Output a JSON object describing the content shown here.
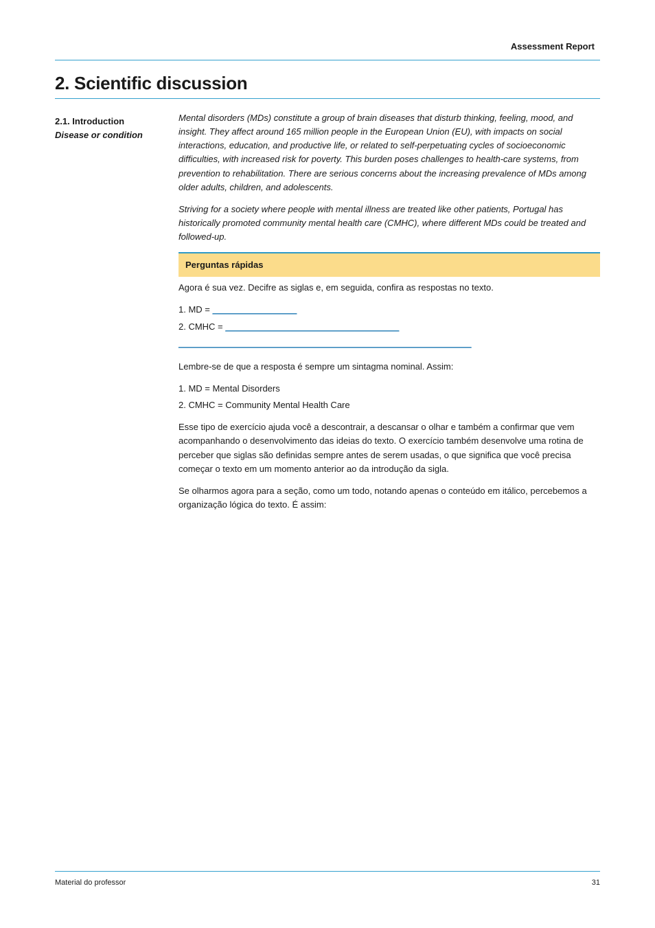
{
  "header": {
    "doc_title": "Assessment Report"
  },
  "section": {
    "number": "2.",
    "title": "Scientific discussion"
  },
  "left": {
    "heading": "2.1. Introduction",
    "sub": "Disease or condition"
  },
  "paragraphs": {
    "p1": "Mental disorders (MDs) constitute a group of brain diseases that disturb thinking, feeling, mood, and insight. They affect around 165 million people in the European Union (EU), with impacts on social interactions, education, and productive life, or related to self-perpetuating cycles of socioeconomic difficulties, with increased risk for poverty. This burden poses challenges to health-care systems, from prevention to rehabilitation. There are serious concerns about the increasing prevalence of MDs among older adults, children, and adolescents.",
    "p2": "Striving for a society where people with mental illness are treated like other patients, Portugal has historically promoted community mental health care (CMHC), where different MDs could be treated and followed-up.",
    "highlight": "Perguntas rápidas",
    "q_intro": "Agora é sua vez. Decifre as siglas e, em seguida, confira as respostas no texto.",
    "q1_label": "1. MD = ",
    "q1_link": "_________________",
    "q2_label": "2. CMHC = ",
    "q2_link": "___________________________________",
    "blank_line": "___________________________________________________________",
    "ans_intro": "Lembre-se de que a resposta é sempre um sintagma nominal. Assim:",
    "ans1": "1. MD = Mental Disorders",
    "ans2": "2. CMHC = Community Mental Health Care",
    "p3": "Esse tipo de exercício ajuda você a descontrair, a descansar o olhar e também a confirmar que vem acompanhando o desenvolvimento das ideias do texto. O exercício também desenvolve uma rotina de perceber que siglas são definidas sempre antes de serem usadas, o que significa que você precisa começar o texto em um momento anterior ao da introdução da sigla.",
    "p4": "Se olharmos agora para a seção, como um todo, notando apenas o conteúdo em itálico, percebemos a organização lógica do texto. É assim:"
  },
  "footer": {
    "left": "Material do professor",
    "right": "31"
  }
}
